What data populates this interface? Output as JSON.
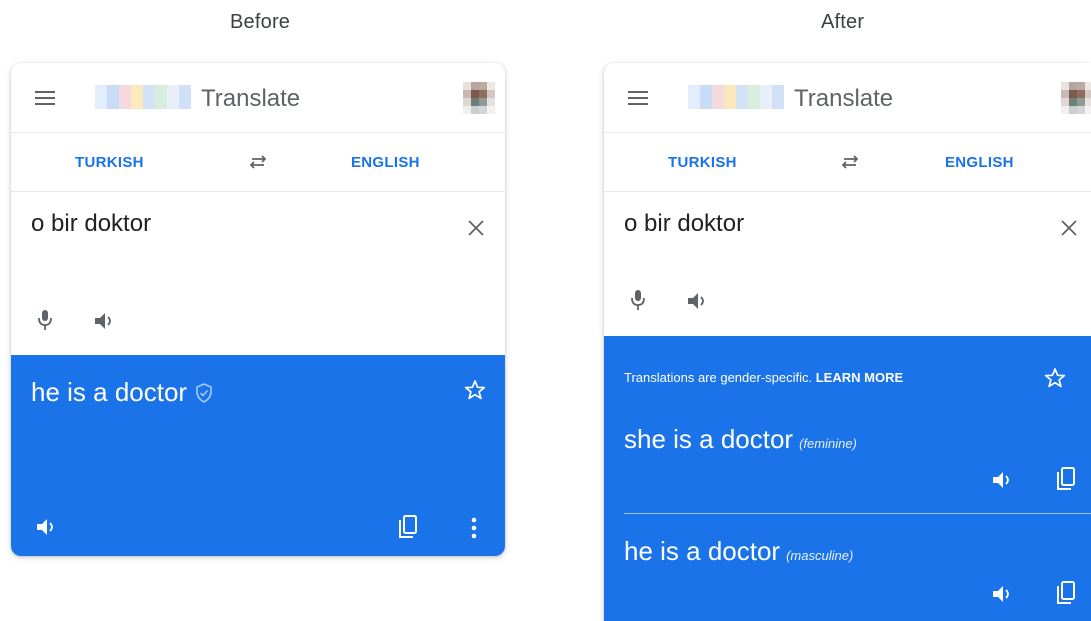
{
  "captions": {
    "before": "Before",
    "after": "After"
  },
  "app": {
    "title": "Translate"
  },
  "languages": {
    "source": "TURKISH",
    "target": "ENGLISH"
  },
  "input": {
    "text": "o bir doktor"
  },
  "before": {
    "translation": "he is a doctor"
  },
  "after": {
    "notice_text": "Translations are gender-specific.",
    "notice_link": "LEARN MORE",
    "results": [
      {
        "text": "she is a doctor",
        "gender": "(feminine)"
      },
      {
        "text": "he is a doctor",
        "gender": "(masculine)"
      }
    ]
  },
  "colors": {
    "accent": "#1a73e8",
    "icon": "#5f6368",
    "text": "#202124"
  },
  "icons": [
    "menu-icon",
    "swap-icon",
    "close-icon",
    "mic-icon",
    "speaker-icon",
    "star-icon",
    "copy-icon",
    "more-icon",
    "shield-icon"
  ]
}
